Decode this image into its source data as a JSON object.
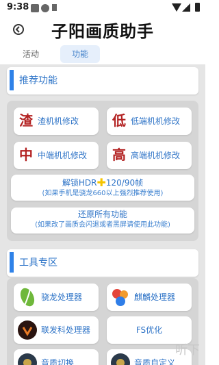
{
  "status": {
    "time": "9:38"
  },
  "app": {
    "title": "子阳画质助手"
  },
  "tabs": [
    {
      "label": "活动",
      "active": false
    },
    {
      "label": "功能",
      "active": true
    }
  ],
  "section_recommended": {
    "title": "推荐功能"
  },
  "recommended": {
    "items": [
      {
        "glyph": "渣",
        "label": "渣机机修改",
        "glyph_color": "#b32222"
      },
      {
        "glyph": "低",
        "label": "低端机机修改",
        "glyph_color": "#b32222"
      },
      {
        "glyph": "中",
        "label": "中端机机修改",
        "glyph_color": "#b32222"
      },
      {
        "glyph": "高",
        "label": "高端机机修改",
        "glyph_color": "#b32222"
      }
    ],
    "hdr": {
      "part1": "解锁HDR",
      "part2": "120/90帧",
      "note": "(如果手机是骁龙660以上强烈推荐使用)"
    },
    "restore": {
      "title": "还原所有功能",
      "note": "(如果改了画质会闪退或者黑屏请使用此功能)"
    }
  },
  "section_tools": {
    "title": "工具专区"
  },
  "tools": [
    {
      "label": "骁龙处理器",
      "icon": "snapdragon-icon"
    },
    {
      "label": "麒麟处理器",
      "icon": "kirin-icon"
    },
    {
      "label": "联发科处理器",
      "icon": "mediatek-icon"
    },
    {
      "label": "FS优化",
      "icon": ""
    },
    {
      "label": "音质切换",
      "icon": "audio-icon"
    },
    {
      "label": "音质自定义",
      "icon": "audio-icon"
    }
  ],
  "watermark": "听下"
}
